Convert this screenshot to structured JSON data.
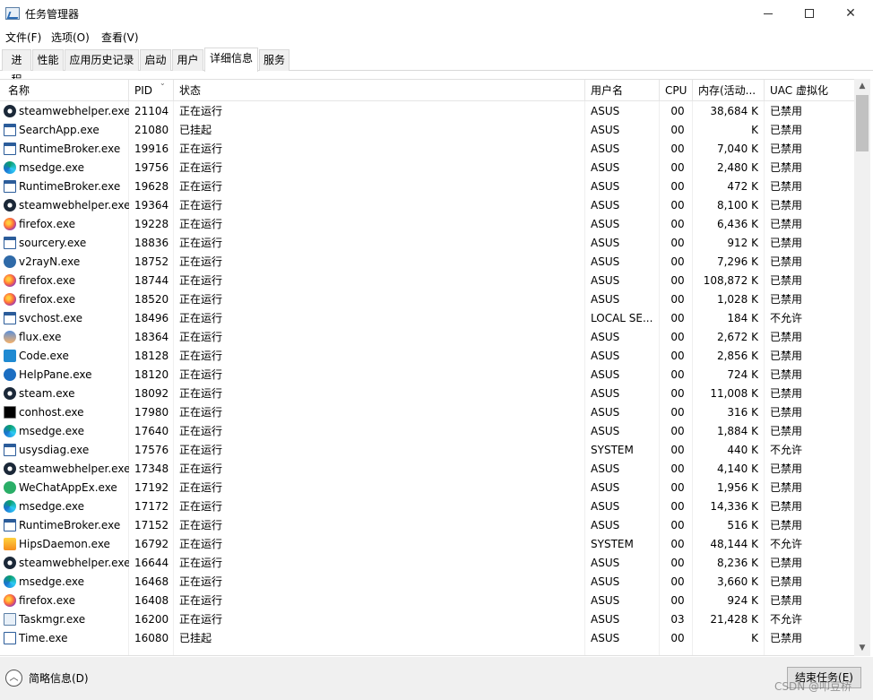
{
  "window": {
    "title": "任务管理器"
  },
  "menu": [
    "文件(F)",
    "选项(O)",
    "查看(V)"
  ],
  "tabs": [
    {
      "label": "进程",
      "active": false
    },
    {
      "label": "性能",
      "active": false
    },
    {
      "label": "应用历史记录",
      "active": false
    },
    {
      "label": "启动",
      "active": false
    },
    {
      "label": "用户",
      "active": false
    },
    {
      "label": "详细信息",
      "active": true
    },
    {
      "label": "服务",
      "active": false
    }
  ],
  "columns": {
    "name": "名称",
    "pid": "PID",
    "status": "状态",
    "user": "用户名",
    "cpu": "CPU",
    "memory": "内存(活动...",
    "uac": "UAC 虚拟化"
  },
  "rows": [
    {
      "icon": "steam-icon",
      "name": "steamwebhelper.exe",
      "pid": "21104",
      "status": "正在运行",
      "user": "ASUS",
      "cpu": "00",
      "memory": "38,684 K",
      "uac": "已禁用"
    },
    {
      "icon": "window-icon",
      "name": "SearchApp.exe",
      "pid": "21080",
      "status": "已挂起",
      "user": "ASUS",
      "cpu": "00",
      "memory": "K",
      "uac": "已禁用"
    },
    {
      "icon": "window-icon",
      "name": "RuntimeBroker.exe",
      "pid": "19916",
      "status": "正在运行",
      "user": "ASUS",
      "cpu": "00",
      "memory": "7,040 K",
      "uac": "已禁用"
    },
    {
      "icon": "edge-icon",
      "name": "msedge.exe",
      "pid": "19756",
      "status": "正在运行",
      "user": "ASUS",
      "cpu": "00",
      "memory": "2,480 K",
      "uac": "已禁用"
    },
    {
      "icon": "window-icon",
      "name": "RuntimeBroker.exe",
      "pid": "19628",
      "status": "正在运行",
      "user": "ASUS",
      "cpu": "00",
      "memory": "472 K",
      "uac": "已禁用"
    },
    {
      "icon": "steam-icon",
      "name": "steamwebhelper.exe",
      "pid": "19364",
      "status": "正在运行",
      "user": "ASUS",
      "cpu": "00",
      "memory": "8,100 K",
      "uac": "已禁用"
    },
    {
      "icon": "firefox-icon",
      "name": "firefox.exe",
      "pid": "19228",
      "status": "正在运行",
      "user": "ASUS",
      "cpu": "00",
      "memory": "6,436 K",
      "uac": "已禁用"
    },
    {
      "icon": "window-icon",
      "name": "sourcery.exe",
      "pid": "18836",
      "status": "正在运行",
      "user": "ASUS",
      "cpu": "00",
      "memory": "912 K",
      "uac": "已禁用"
    },
    {
      "icon": "v2ray-icon",
      "name": "v2rayN.exe",
      "pid": "18752",
      "status": "正在运行",
      "user": "ASUS",
      "cpu": "00",
      "memory": "7,296 K",
      "uac": "已禁用"
    },
    {
      "icon": "firefox-icon",
      "name": "firefox.exe",
      "pid": "18744",
      "status": "正在运行",
      "user": "ASUS",
      "cpu": "00",
      "memory": "108,872 K",
      "uac": "已禁用"
    },
    {
      "icon": "firefox-icon",
      "name": "firefox.exe",
      "pid": "18520",
      "status": "正在运行",
      "user": "ASUS",
      "cpu": "00",
      "memory": "1,028 K",
      "uac": "已禁用"
    },
    {
      "icon": "window-icon",
      "name": "svchost.exe",
      "pid": "18496",
      "status": "正在运行",
      "user": "LOCAL SE...",
      "cpu": "00",
      "memory": "184 K",
      "uac": "不允许"
    },
    {
      "icon": "flux-icon",
      "name": "flux.exe",
      "pid": "18364",
      "status": "正在运行",
      "user": "ASUS",
      "cpu": "00",
      "memory": "2,672 K",
      "uac": "已禁用"
    },
    {
      "icon": "vscode-icon",
      "name": "Code.exe",
      "pid": "18128",
      "status": "正在运行",
      "user": "ASUS",
      "cpu": "00",
      "memory": "2,856 K",
      "uac": "已禁用"
    },
    {
      "icon": "help-icon",
      "name": "HelpPane.exe",
      "pid": "18120",
      "status": "正在运行",
      "user": "ASUS",
      "cpu": "00",
      "memory": "724 K",
      "uac": "已禁用"
    },
    {
      "icon": "steam-icon",
      "name": "steam.exe",
      "pid": "18092",
      "status": "正在运行",
      "user": "ASUS",
      "cpu": "00",
      "memory": "11,008 K",
      "uac": "已禁用"
    },
    {
      "icon": "console-icon",
      "name": "conhost.exe",
      "pid": "17980",
      "status": "正在运行",
      "user": "ASUS",
      "cpu": "00",
      "memory": "316 K",
      "uac": "已禁用"
    },
    {
      "icon": "edge-icon",
      "name": "msedge.exe",
      "pid": "17640",
      "status": "正在运行",
      "user": "ASUS",
      "cpu": "00",
      "memory": "1,884 K",
      "uac": "已禁用"
    },
    {
      "icon": "window-icon",
      "name": "usysdiag.exe",
      "pid": "17576",
      "status": "正在运行",
      "user": "SYSTEM",
      "cpu": "00",
      "memory": "440 K",
      "uac": "不允许"
    },
    {
      "icon": "steam-icon",
      "name": "steamwebhelper.exe",
      "pid": "17348",
      "status": "正在运行",
      "user": "ASUS",
      "cpu": "00",
      "memory": "4,140 K",
      "uac": "已禁用"
    },
    {
      "icon": "wechat-icon",
      "name": "WeChatAppEx.exe",
      "pid": "17192",
      "status": "正在运行",
      "user": "ASUS",
      "cpu": "00",
      "memory": "1,956 K",
      "uac": "已禁用"
    },
    {
      "icon": "edge-icon",
      "name": "msedge.exe",
      "pid": "17172",
      "status": "正在运行",
      "user": "ASUS",
      "cpu": "00",
      "memory": "14,336 K",
      "uac": "已禁用"
    },
    {
      "icon": "window-icon",
      "name": "RuntimeBroker.exe",
      "pid": "17152",
      "status": "正在运行",
      "user": "ASUS",
      "cpu": "00",
      "memory": "516 K",
      "uac": "已禁用"
    },
    {
      "icon": "hips-icon",
      "name": "HipsDaemon.exe",
      "pid": "16792",
      "status": "正在运行",
      "user": "SYSTEM",
      "cpu": "00",
      "memory": "48,144 K",
      "uac": "不允许"
    },
    {
      "icon": "steam-icon",
      "name": "steamwebhelper.exe",
      "pid": "16644",
      "status": "正在运行",
      "user": "ASUS",
      "cpu": "00",
      "memory": "8,236 K",
      "uac": "已禁用"
    },
    {
      "icon": "edge-icon",
      "name": "msedge.exe",
      "pid": "16468",
      "status": "正在运行",
      "user": "ASUS",
      "cpu": "00",
      "memory": "3,660 K",
      "uac": "已禁用"
    },
    {
      "icon": "firefox-icon",
      "name": "firefox.exe",
      "pid": "16408",
      "status": "正在运行",
      "user": "ASUS",
      "cpu": "00",
      "memory": "924 K",
      "uac": "已禁用"
    },
    {
      "icon": "taskmgr-icon",
      "name": "Taskmgr.exe",
      "pid": "16200",
      "status": "正在运行",
      "user": "ASUS",
      "cpu": "03",
      "memory": "21,428 K",
      "uac": "不允许"
    },
    {
      "icon": "time-icon",
      "name": "Time.exe",
      "pid": "16080",
      "status": "已挂起",
      "user": "ASUS",
      "cpu": "00",
      "memory": "K",
      "uac": "已禁用"
    }
  ],
  "footer": {
    "fewer_details": "简略信息(D)",
    "end_task": "结束任务(E)",
    "watermark": "CSDN @叩豆桥"
  }
}
